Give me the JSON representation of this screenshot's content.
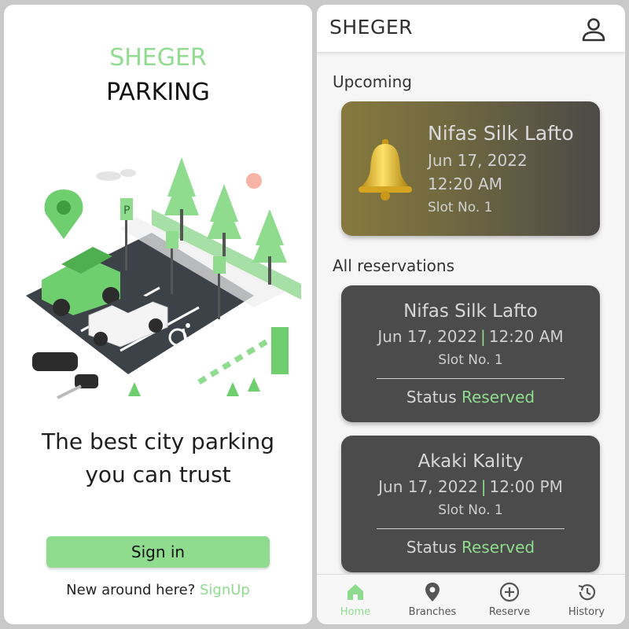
{
  "left": {
    "brand_line1": "SHEGER",
    "brand_line2": "PARKING",
    "tagline_line1": "The best city parking",
    "tagline_line2": "you can trust",
    "signin_label": "Sign in",
    "new_around_text": "New around here?",
    "signup_link": "SignUp"
  },
  "right": {
    "app_title": "SHEGER",
    "upcoming_title": "Upcoming",
    "upcoming": {
      "name": "Nifas Silk Lafto",
      "date": "Jun 17, 2022",
      "time": "12:20 AM",
      "slot": "Slot No. 1"
    },
    "all_title": "All reservations",
    "reservations": [
      {
        "name": "Nifas Silk Lafto",
        "date": "Jun 17, 2022",
        "time": "12:20 AM",
        "slot": "Slot No. 1",
        "status_label": "Status",
        "status_value": "Reserved"
      },
      {
        "name": "Akaki Kality",
        "date": "Jun 17, 2022",
        "time": "12:00 PM",
        "slot": "Slot No. 1",
        "status_label": "Status",
        "status_value": "Reserved"
      }
    ],
    "datetime_separator": "|",
    "nav": [
      {
        "label": "Home",
        "icon": "home-icon",
        "active": true
      },
      {
        "label": "Branches",
        "icon": "location-pin-icon",
        "active": false
      },
      {
        "label": "Reserve",
        "icon": "plus-circle-icon",
        "active": false
      },
      {
        "label": "History",
        "icon": "history-icon",
        "active": false
      }
    ]
  },
  "colors": {
    "accent_green": "#8fdc8f",
    "card_dark": "#4b4b4b",
    "card_gold_start": "#87793e",
    "background": "#c9c9c9"
  }
}
